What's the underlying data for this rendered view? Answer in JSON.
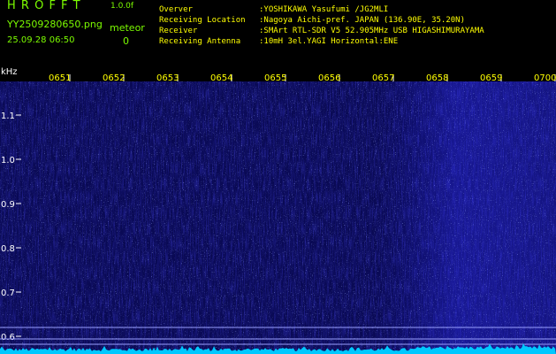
{
  "app": {
    "name": "H R O F F T",
    "version": "1.0.0f",
    "filename": "YY2509280650.png",
    "timestamp": "25.09.28 06:50",
    "meteor_label": "meteor",
    "meteor_count": "0"
  },
  "info": {
    "labels": [
      "Overver",
      "Receiving Location",
      "Receiver",
      "Receiving Antenna"
    ],
    "values": [
      ":YOSHIKAWA Yasufumi /JG2MLI",
      ":Nagoya Aichi-pref. JAPAN (136.90E, 35.20N)",
      ":SMArt RTL-SDR V5 52.905MHz USB HIGASHIMURAYAMA",
      ":10mH 3el.YAGI Horizontal:ENE"
    ]
  },
  "axis": {
    "unit": "kHz",
    "time_labels": [
      "0651",
      "0652",
      "0653",
      "0654",
      "0655",
      "0656",
      "0657",
      "0658",
      "0659",
      "0700"
    ],
    "freq_labels": [
      "1.1",
      "1.0",
      "0.9",
      "0.8",
      "0.7",
      "0.6"
    ]
  },
  "colors": {
    "background": "#000000",
    "app_text": "#7CFC00",
    "info_text": "#FFFF00",
    "spectrum_base": "#0A0A55",
    "signal": "#00C8FF"
  }
}
